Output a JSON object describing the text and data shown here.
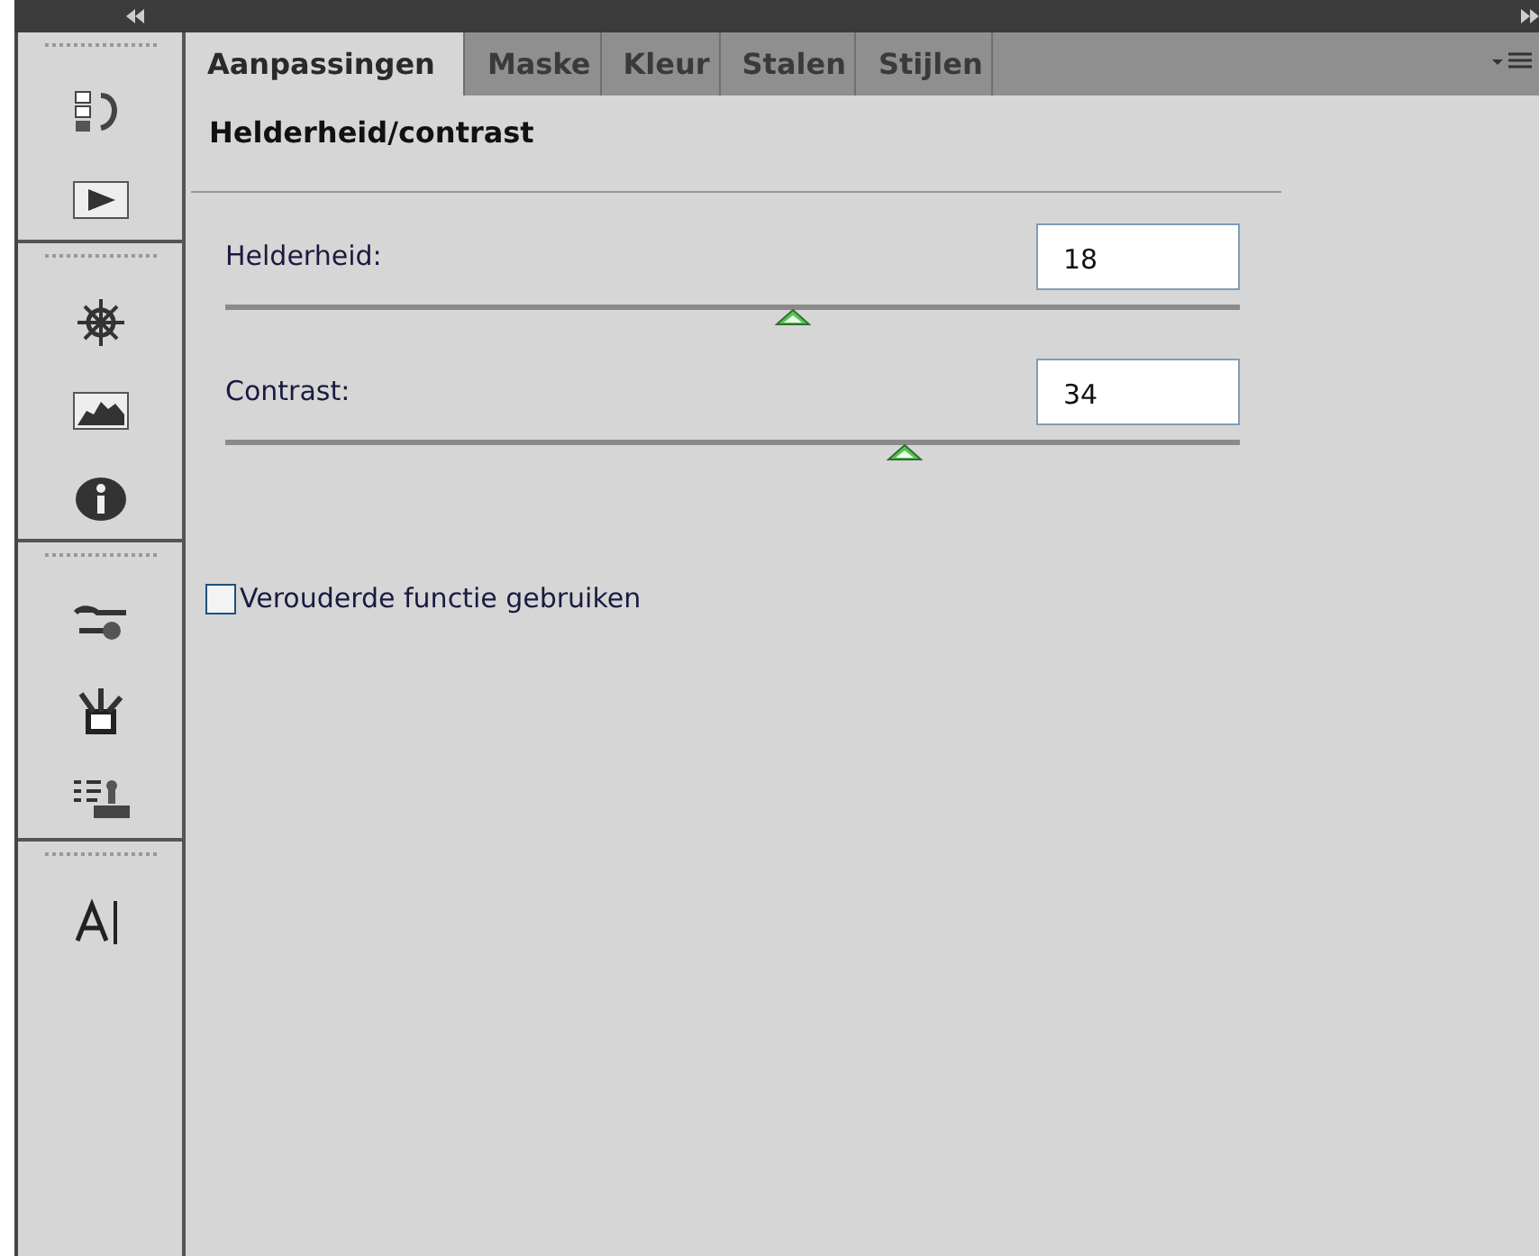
{
  "tabs": [
    {
      "label": "Aanpassingen",
      "selected": true
    },
    {
      "label": "Maske",
      "selected": false
    },
    {
      "label": "Kleur",
      "selected": false
    },
    {
      "label": "Stalen",
      "selected": false
    },
    {
      "label": "Stijlen",
      "selected": false
    }
  ],
  "panel_title": "Helderheid/contrast",
  "sliders": [
    {
      "label": "Helderheid:",
      "value": "18",
      "level": 0.56
    },
    {
      "label": "Contrast:",
      "value": "34",
      "level": 0.67
    }
  ],
  "option": {
    "label": "Verouderde functie gebruiken",
    "checked": false
  }
}
